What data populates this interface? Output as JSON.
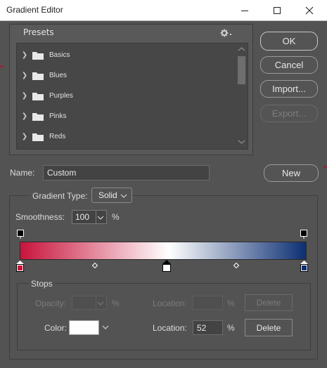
{
  "window": {
    "title": "Gradient Editor"
  },
  "presets": {
    "title": "Presets",
    "items": [
      {
        "label": "Basics"
      },
      {
        "label": "Blues"
      },
      {
        "label": "Purples"
      },
      {
        "label": "Pinks"
      },
      {
        "label": "Reds"
      }
    ]
  },
  "buttons": {
    "ok": "OK",
    "cancel": "Cancel",
    "import": "Import...",
    "export": "Export...",
    "new": "New"
  },
  "name": {
    "label": "Name:",
    "value": "Custom"
  },
  "gradient_type": {
    "label": "Gradient Type:",
    "value": "Solid"
  },
  "smoothness": {
    "label": "Smoothness:",
    "value": "100",
    "unit": "%"
  },
  "gradient": {
    "colors": [
      "#c8143c",
      "#ffffff",
      "#0c2f73"
    ]
  },
  "stops": {
    "title": "Stops",
    "opacity_label": "Opacity:",
    "opacity_unit": "%",
    "opacity_location_label": "Location:",
    "opacity_location_unit": "%",
    "opacity_delete": "Delete",
    "color_label": "Color:",
    "color_value": "#ffffff",
    "color_location_label": "Location:",
    "color_location_value": "52",
    "color_location_unit": "%",
    "color_delete": "Delete"
  }
}
